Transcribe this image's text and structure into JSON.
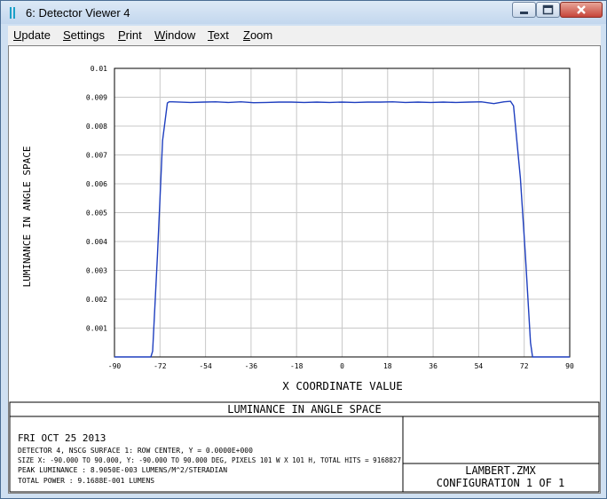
{
  "window": {
    "title": "6: Detector Viewer 4",
    "accent": "#1aa0c8"
  },
  "menu": [
    {
      "label": "Update",
      "hotkey": "U"
    },
    {
      "label": "Settings",
      "hotkey": "S"
    },
    {
      "label": "Print",
      "hotkey": "P"
    },
    {
      "label": "Window",
      "hotkey": "W"
    },
    {
      "label": "Text",
      "hotkey": "T"
    },
    {
      "label": "Zoom",
      "hotkey": "Z"
    }
  ],
  "chart_data": {
    "type": "line",
    "xlabel": "X COORDINATE VALUE",
    "ylabel": "LUMINANCE IN ANGLE SPACE",
    "xlim": [
      -90,
      90
    ],
    "ylim": [
      0,
      0.01
    ],
    "xticks": [
      "-90",
      "-72",
      "-54",
      "-36",
      "-18",
      "0",
      "18",
      "36",
      "54",
      "72",
      "90"
    ],
    "yticks": [
      "0.01",
      "0.009",
      "0.008",
      "0.007",
      "0.006",
      "0.005",
      "0.004",
      "0.003",
      "0.002",
      "0.001"
    ],
    "grid": true,
    "line_color": "#1f3fbf",
    "series": [
      {
        "x": [
          -90,
          -75.6,
          -74.9,
          -73,
          -71,
          -69.1,
          -68.4,
          -67,
          -60,
          -55,
          -50,
          -45,
          -40,
          -35,
          -30,
          -25,
          -20,
          -15,
          -10,
          -5,
          0,
          5,
          10,
          15,
          20,
          25,
          30,
          35,
          40,
          45,
          50,
          55,
          60,
          64,
          66.6,
          67.8,
          70.5,
          72.5,
          74.5,
          75.3,
          90
        ],
        "y": [
          0,
          0,
          0.0002,
          0.0035,
          0.0075,
          0.0088,
          0.00884,
          0.00884,
          0.00882,
          0.00883,
          0.00884,
          0.00882,
          0.00884,
          0.00881,
          0.00882,
          0.00883,
          0.00883,
          0.00882,
          0.00883,
          0.00882,
          0.00883,
          0.00882,
          0.00883,
          0.00883,
          0.00884,
          0.00882,
          0.00883,
          0.00882,
          0.00883,
          0.00882,
          0.00883,
          0.00884,
          0.00878,
          0.00884,
          0.00886,
          0.0087,
          0.0062,
          0.0035,
          0.0005,
          0,
          0
        ]
      }
    ]
  },
  "footer": {
    "title": "LUMINANCE IN ANGLE SPACE",
    "date": "FRI OCT 25 2013",
    "lines": [
      "DETECTOR 4, NSCG SURFACE 1: ROW CENTER, Y = 0.0000E+000",
      "SIZE X: -90.000 TO 90.000, Y: -90.000 TO 90.000 DEG, PIXELS 101 W X 101 H, TOTAL HITS = 9168827",
      "PEAK LUMINANCE  : 8.9050E-003 LUMENS/M^2/STERADIAN",
      "TOTAL POWER     : 9.1688E-001 LUMENS"
    ],
    "file": "LAMBERT.ZMX",
    "config": "CONFIGURATION 1 OF 1"
  }
}
